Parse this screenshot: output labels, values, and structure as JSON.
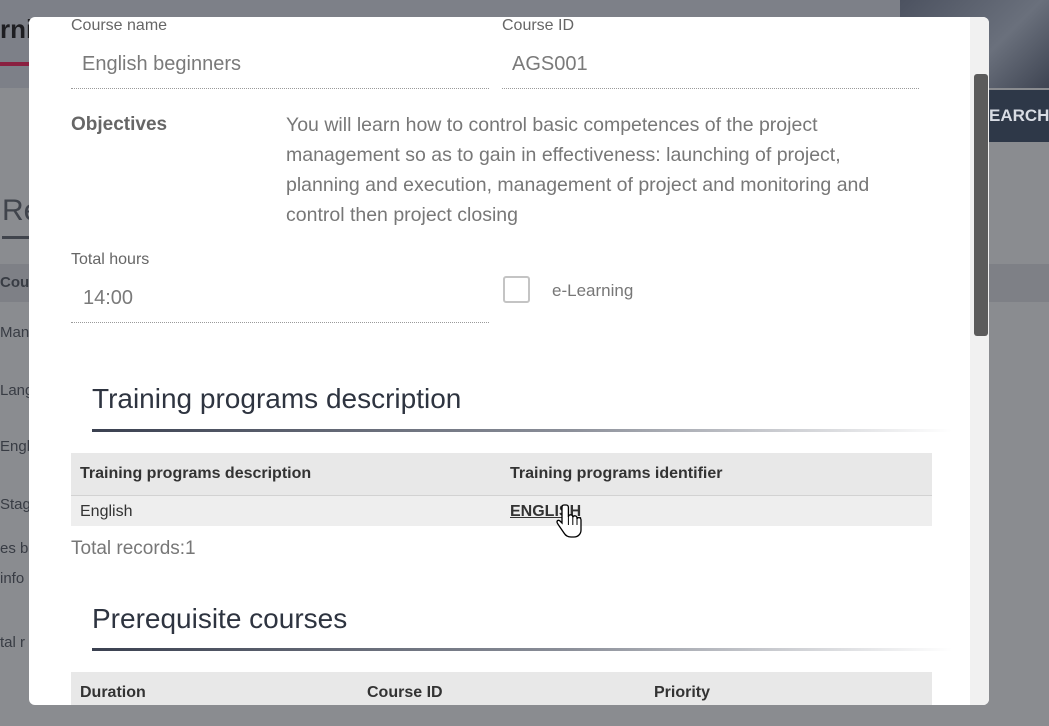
{
  "background": {
    "logo_fragment": "rni",
    "search_fragment": "EARCH",
    "section_fragment": "Re",
    "column_fragment": "Cour",
    "rows": [
      "Mana",
      "Lang",
      "Engli",
      "Stage",
      "es b",
      "info",
      "tal r"
    ]
  },
  "modal": {
    "course_name": {
      "label": "Course name",
      "value": "English beginners"
    },
    "course_id": {
      "label": "Course ID",
      "value": "AGS001"
    },
    "objectives": {
      "label": "Objectives",
      "lines": [
        "You will learn how to control basic competences of the project",
        "management so as to gain in effectiveness: launching of project,",
        "planning and execution, management of project and monitoring and",
        "control then project closing"
      ]
    },
    "total_hours": {
      "label": "Total hours",
      "value": "14:00"
    },
    "elearning": {
      "label": "e-Learning",
      "checked": false
    },
    "training_section": {
      "title": "Training programs description",
      "columns": [
        "Training programs description",
        "Training programs identifier"
      ],
      "rows": [
        {
          "description": "English",
          "identifier": "ENGLISH"
        }
      ],
      "total": "Total records:1"
    },
    "prereq_section": {
      "title": "Prerequisite courses",
      "columns": [
        "Duration",
        "Course ID",
        "Priority"
      ]
    }
  },
  "colors": {
    "overlay": "#7a7c80",
    "modal_bg": "#ffffff",
    "table_header": "#e8e8e8",
    "scroll_thumb": "#5b5b5b"
  }
}
